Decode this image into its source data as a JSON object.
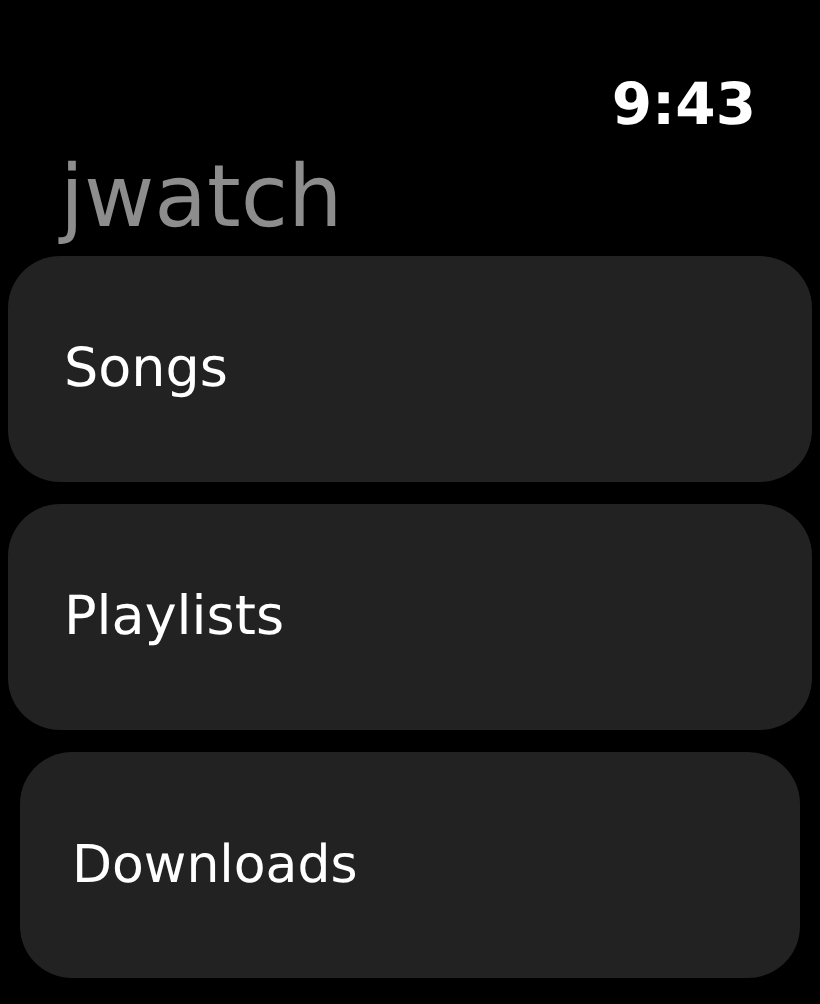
{
  "status_bar": {
    "time": "9:43"
  },
  "app": {
    "title": "jwatch"
  },
  "menu_items": [
    {
      "label": "Songs"
    },
    {
      "label": "Playlists"
    },
    {
      "label": "Downloads"
    }
  ]
}
